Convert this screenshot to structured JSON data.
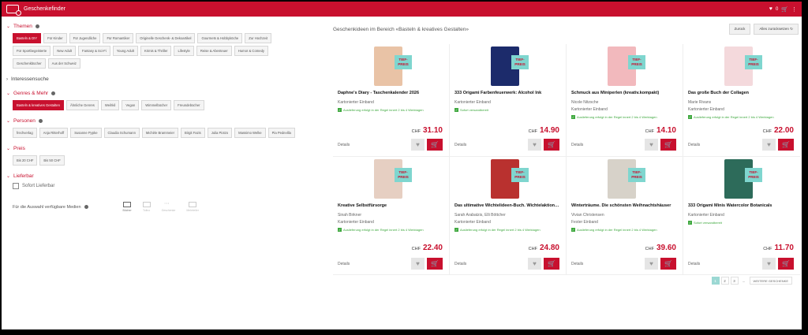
{
  "app": {
    "title": "Geschenkefinder",
    "cart_count": "0"
  },
  "sidebar": {
    "themen": {
      "title": "Themen",
      "chips": [
        "Basteln & DIY",
        "Für Kinder",
        "Für Jugendliche",
        "Für Romantiker",
        "Originelle Geschenk- & Dekoartikel",
        "Gourmets & Hobbyköche",
        "Zur Hochzeit",
        "Für Sportbegeisterte",
        "New Adult",
        "Fantasy & Sci-Fi",
        "Young Adult",
        "Krimis & Thriller",
        "Lifestyle",
        "Reise & Abenteuer",
        "Humor & Comedy",
        "Geschenkbücher",
        "Aus der Schweiz"
      ]
    },
    "interessen": {
      "title": "Interessensuche"
    },
    "genres": {
      "title": "Genres & Mehr",
      "chips": [
        "Basteln & kreatives Gestalten",
        "Ähnliche Genres",
        "Weihkil",
        "Vegan",
        "Wimmelbücher",
        "Freundebücher"
      ]
    },
    "personen": {
      "title": "Personen",
      "chips": [
        "frechverlag",
        "Anja Ritterhoff",
        "Susanne Pypke",
        "Claudia Schumann",
        "Michèle Brammeier",
        "Birgit Fazis",
        "Julia Piotzo",
        "Massimo Welke",
        "Pia Pedevilla"
      ]
    },
    "preis": {
      "title": "Preis",
      "chips": [
        "Bis 20 CHF",
        "Bis 50 CHF"
      ]
    },
    "lieferbar": {
      "title": "Lieferbar",
      "checkbox_label": "Sofort Lieferbar"
    },
    "media": {
      "label": "Für die Auswahl verfügbare Medien",
      "items": [
        "Bücher",
        "Tolino",
        "Geschenke",
        "Mehrteiler"
      ]
    }
  },
  "main": {
    "heading": "Geschenkideen im Bereich «Basteln & kreatives Gestalten»",
    "back_label": "Zurück",
    "reset_label": "Alles zurücksetzen",
    "badge_text": "TIEF-PREIS",
    "currency": "CHF",
    "details_label": "Details",
    "products": [
      {
        "title": "Daphne's Diary - Taschenkalender 2026",
        "lines": [
          "Kartonierter Einband"
        ],
        "availability": "Auslieferung erfolgt in der Regel innert 2 bis 4 Werktagen",
        "price": "31.10",
        "cover_color": "#e9c3a6"
      },
      {
        "title": "333 Origami Farbenfeuerwerk: Alcohol Ink",
        "lines": [
          "Kartonierter Einband"
        ],
        "availability": "Sofort versandbereit",
        "price": "14.90",
        "cover_color": "#1c2b6b"
      },
      {
        "title": "Schmuck aus Miniperlen (kreativ.kompakt)",
        "lines": [
          "Nicole Nitzsche",
          "Kartonierter Einband"
        ],
        "availability": "Auslieferung erfolgt in der Regel innert 2 bis 4 Werktagen",
        "price": "14.10",
        "cover_color": "#f2b9bd"
      },
      {
        "title": "Das große Buch der Collagen",
        "lines": [
          "Marie Rivans",
          "Kartonierter Einband"
        ],
        "availability": "Auslieferung erfolgt in der Regel innert 2 bis 4 Werktagen",
        "price": "22.00",
        "cover_color": "#f4d9dc"
      },
      {
        "title": "Kreative Selbstfürsorge",
        "lines": [
          "Sinah Birkner",
          "Kartonierter Einband"
        ],
        "availability": "Auslieferung erfolgt in der Regel innert 2 bis 4 Werktagen",
        "price": "22.40",
        "cover_color": "#e6cfc2"
      },
      {
        "title": "Das ultimative Wichtelideen-Buch. Wichtelaktionen für Kinder",
        "lines": [
          "Sarah Arabatzis, Elli Böttcher",
          "Kartonierter Einband"
        ],
        "availability": "Auslieferung erfolgt in der Regel innert 2 bis 4 Werktagen",
        "price": "24.80",
        "cover_color": "#b9312f"
      },
      {
        "title": "Winterträume. Die schönsten Weihnachtshäuser",
        "lines": [
          "Vivian Christensen",
          "Fester Einband"
        ],
        "availability": "Auslieferung erfolgt in der Regel innert 2 bis 4 Werktagen",
        "price": "39.60",
        "cover_color": "#d7d2c9"
      },
      {
        "title": "333 Origami Minis Watercolor Botanicals",
        "lines": [
          "Kartonierter Einband"
        ],
        "availability": "Sofort versandbereit",
        "price": "11.70",
        "cover_color": "#2d6b5a"
      }
    ],
    "pager": {
      "pages": [
        "1",
        "2",
        "3"
      ],
      "more": "...",
      "next_label": "WEITERE GESCHENKE"
    }
  },
  "colors": {
    "brand": "#c8102e",
    "badge": "#7fd6cf",
    "available": "#3ea83e"
  }
}
